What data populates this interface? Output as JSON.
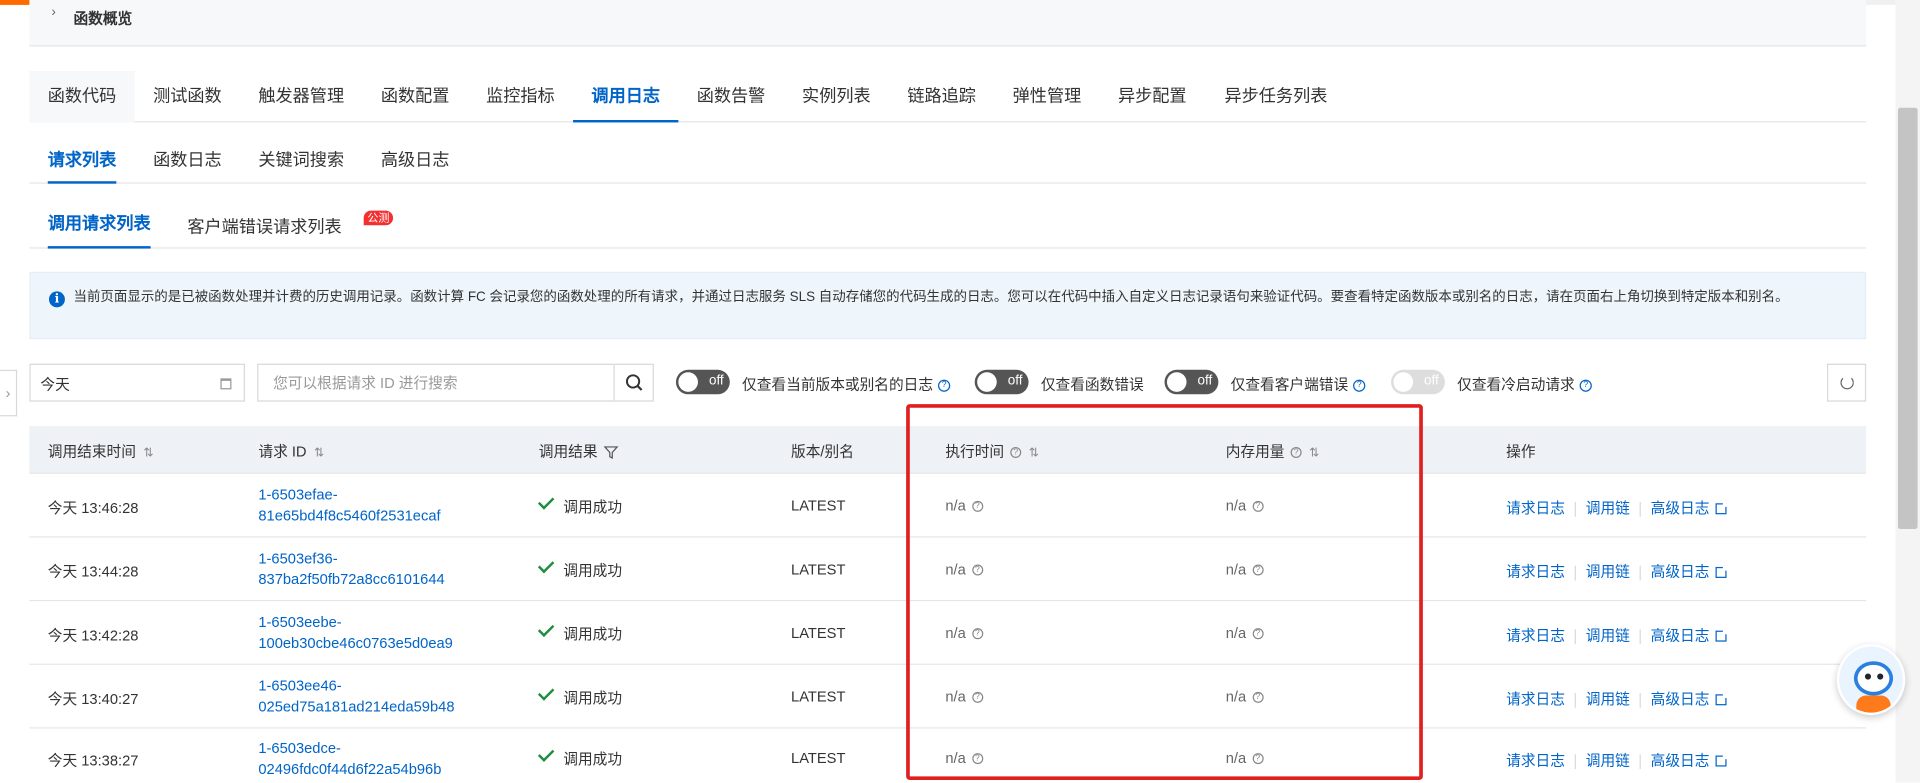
{
  "overview": {
    "chevron": "›",
    "title": "函数概览"
  },
  "main_tabs": [
    {
      "label": "函数代码"
    },
    {
      "label": "测试函数"
    },
    {
      "label": "触发器管理"
    },
    {
      "label": "函数配置"
    },
    {
      "label": "监控指标"
    },
    {
      "label": "调用日志"
    },
    {
      "label": "函数告警"
    },
    {
      "label": "实例列表"
    },
    {
      "label": "链路追踪"
    },
    {
      "label": "弹性管理"
    },
    {
      "label": "异步配置"
    },
    {
      "label": "异步任务列表"
    }
  ],
  "main_tab_active": "调用日志",
  "log_tabs": [
    {
      "label": "请求列表"
    },
    {
      "label": "函数日志"
    },
    {
      "label": "关键词搜索"
    },
    {
      "label": "高级日志"
    }
  ],
  "request_tabs": [
    {
      "label": "调用请求列表"
    },
    {
      "label": "客户端错误请求列表"
    }
  ],
  "request_tab_badge": "公测",
  "notice": {
    "icon": "i",
    "text": "当前页面显示的是已被函数处理并计费的历史调用记录。函数计算 FC 会记录您的函数处理的所有请求，并通过日志服务 SLS 自动存储您的代码生成的日志。您可以在代码中插入自定义日志记录语句来验证代码。要查看特定函数版本或别名的日志，请在页面右上角切换到特定版本和别名。"
  },
  "filters": {
    "date_value": "今天",
    "search_placeholder": "您可以根据请求 ID 进行搜索",
    "toggles": [
      {
        "state": "off",
        "label": "仅查看当前版本或别名的日志",
        "help": true,
        "disabled": false
      },
      {
        "state": "off",
        "label": "仅查看函数错误",
        "help": false,
        "disabled": false
      },
      {
        "state": "off",
        "label": "仅查看客户端错误",
        "help": true,
        "disabled": false
      },
      {
        "state": "off",
        "label": "仅查看冷启动请求",
        "help": true,
        "disabled": true
      }
    ]
  },
  "table": {
    "headers": {
      "end_time": "调用结束时间",
      "request_id": "请求 ID",
      "result": "调用结果",
      "version": "版本/别名",
      "exec_time": "执行时间",
      "memory": "内存用量",
      "actions": "操作"
    },
    "sort_icon": "⇅",
    "rows": [
      {
        "time": "今天 13:46:28",
        "id_line1": "1-6503efae-",
        "id_line2": "81e65bd4f8c5460f2531ecaf",
        "result": "调用成功",
        "version": "LATEST",
        "exec": "n/a",
        "mem": "n/a"
      },
      {
        "time": "今天 13:44:28",
        "id_line1": "1-6503ef36-",
        "id_line2": "837ba2f50fb72a8cc6101644",
        "result": "调用成功",
        "version": "LATEST",
        "exec": "n/a",
        "mem": "n/a"
      },
      {
        "time": "今天 13:42:28",
        "id_line1": "1-6503eebe-",
        "id_line2": "100eb30cbe46c0763e5d0ea9",
        "result": "调用成功",
        "version": "LATEST",
        "exec": "n/a",
        "mem": "n/a"
      },
      {
        "time": "今天 13:40:27",
        "id_line1": "1-6503ee46-",
        "id_line2": "025ed75a181ad214eda59b48",
        "result": "调用成功",
        "version": "LATEST",
        "exec": "n/a",
        "mem": "n/a"
      },
      {
        "time": "今天 13:38:27",
        "id_line1": "1-6503edce-",
        "id_line2": "02496fdc0f44d6f22a54b96b",
        "result": "调用成功",
        "version": "LATEST",
        "exec": "n/a",
        "mem": "n/a"
      }
    ],
    "actions": {
      "request_log": "请求日志",
      "call_chain": "调用链",
      "advanced_log": "高级日志"
    }
  },
  "colors": {
    "accent": "#0064c8",
    "success": "#1e8e3e",
    "highlight_box": "#e02020",
    "brand": "#ff6a00"
  }
}
